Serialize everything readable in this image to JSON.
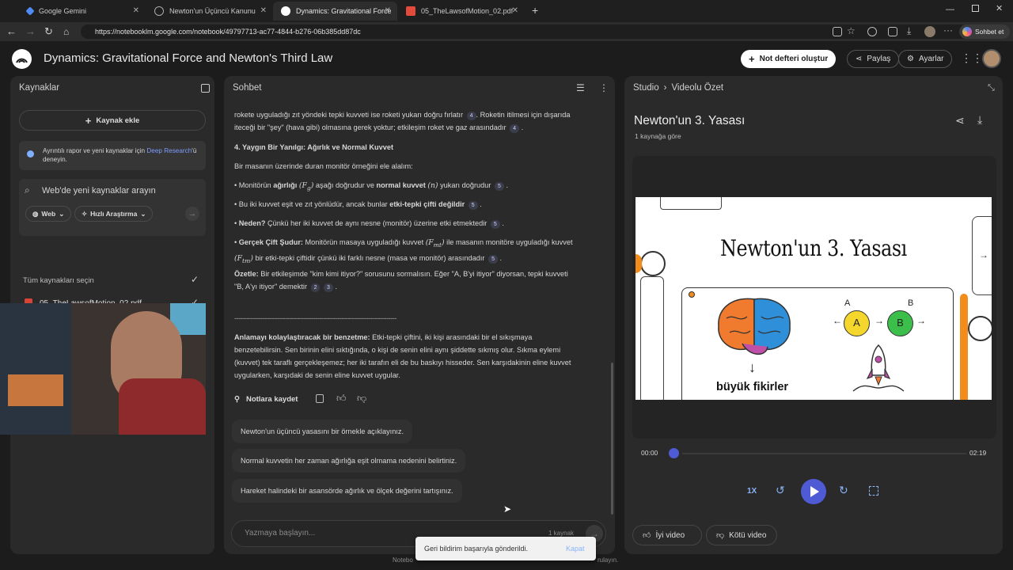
{
  "browser": {
    "tabs": [
      {
        "title": "Google Gemini",
        "active": false
      },
      {
        "title": "Newton'un Üçüncü Kanunu",
        "active": false
      },
      {
        "title": "Dynamics: Gravitational Force and",
        "active": true
      },
      {
        "title": "05_TheLawsofMotion_02.pdf",
        "active": false
      }
    ],
    "url": "https://notebooklm.google.com/notebook/49797713-ac77-4844-b276-06b385dd87dc",
    "profile_label": "Sohbet et"
  },
  "app": {
    "title": "Dynamics: Gravitational Force and Newton's Third Law",
    "new_notebook_label": "Not defteri oluştur",
    "share_label": "Paylaş",
    "settings_label": "Ayarlar"
  },
  "sources": {
    "header": "Kaynaklar",
    "add_label": "Kaynak ekle",
    "promo_text": "Ayrıntılı rapor ve yeni kaynaklar için",
    "promo_link": "Deep Research",
    "promo_suffix": "'ü deneyin.",
    "search_placeholder": "Web'de yeni kaynaklar arayın",
    "chip_web": "Web",
    "chip_research": "Hızlı Araştırma",
    "select_all_label": "Tüm kaynakları seçin",
    "items": [
      {
        "name": "05_TheLawsofMotion_02.pdf"
      }
    ]
  },
  "chat": {
    "header": "Sohbet",
    "p1a": "rokete uyguladığı zıt yöndeki tepki kuvveti ise roketi yukarı doğru fırlatır",
    "p1b": ". Roketin itilmesi için dışarıda",
    "p1c": "iteceği bir \"şey\" (hava gibi) olmasına gerek yoktur; etkileşim roket ve gaz arasındadır",
    "heading4": "4. Yaygın Bir Yanılgı: Ağırlık ve Normal Kuvvet",
    "intro": "Bir masanın üzerinde duran monitör örneğini ele alalım:",
    "b1a": "Monitörün ",
    "b1b": "ağırlığı",
    "b1c": "aşağı doğrudur ve ",
    "b1d": "normal kuvvet",
    "b1e": "yukarı doğrudur",
    "b2a": "Bu iki kuvvet eşit ve zıt yönlüdür, ancak bunlar ",
    "b2b": "etki-tepki çifti değildir",
    "b3a": "Neden?",
    "b3b": " Çünkü her iki kuvvet de aynı nesne (monitör) üzerine etki etmektedir",
    "b4a": "Gerçek Çift Şudur:",
    "b4b": " Monitörün masaya uyguladığı kuvvet",
    "b4c": " ile masanın monitöre uyguladığı kuvvet",
    "b4d": " bir etki-tepki çiftidir çünkü iki farklı nesne (masa ve monitör) arasındadır",
    "sum_a": "Özetle:",
    "sum_b": " Bir etkileşimde \"kim kimi itiyor?\" sorusunu sormalısın. Eğer \"A, B'yi itiyor\" diyorsan, tepki kuvveti",
    "sum_c": "\"B, A'yı itiyor\" demektir",
    "divider": "--------------------------------------------------------------------------------",
    "an_a": "Anlamayı kolaylaştıracak bir benzetme:",
    "an_b": " Etki-tepki çiftini, iki kişi arasındaki bir el sıkışmaya",
    "an_c": "benzetebilirsin. Sen birinin elini sıktığında, o kişi de senin elini aynı şiddette sıkmış olur. Sıkma eylemi",
    "an_d": "(kuvvet) tek taraflı gerçekleşemez; her iki tarafın eli de bu baskıyı hisseder. Sen karşıdakinin eline kuvvet",
    "an_e": "uygularken, karşıdaki de senin eline kuvvet uygular.",
    "save_note_label": "Notlara kaydet",
    "suggestions": [
      "Newton'un üçüncü yasasını bir örnekle açıklayınız.",
      "Normal kuvvetin her zaman ağırlığa eşit olmama nedenini belirtiniz.",
      "Hareket halindeki bir asansörde ağırlık ve ölçek değerini tartışınız."
    ],
    "input_placeholder": "Yazmaya başlayın...",
    "source_count": "1 kaynak",
    "toast_text": "Geri bildirim başarıyla gönderildi.",
    "toast_action": "Kapat",
    "footer_a": "Notebo",
    "footer_b": "rulayın."
  },
  "citations": {
    "c4": "4",
    "c5": "5",
    "c2": "2",
    "c3": "3"
  },
  "math": {
    "fg": "(F",
    "fg_sub": "g",
    "n": "(n)",
    "fmt": "(F",
    "fmt_sub": "mt",
    "ftm": "(F",
    "ftm_sub": "tm"
  },
  "studio": {
    "breadcrumb_root": "Studio",
    "breadcrumb_leaf": "Videolu Özet",
    "title": "Newton'un 3. Yasası",
    "subtitle": "1 kaynağa göre",
    "slide_title": "Newton'un 3. Yasası",
    "slide_caption": "büyük fikirler",
    "label_a": "A",
    "label_b": "B",
    "time_current": "00:00",
    "time_total": "02:19",
    "progress": 0.0,
    "speed": "1X",
    "good_label": "İyi video",
    "bad_label": "Kötü video"
  },
  "colors": {
    "accent": "#4f5bd5",
    "link": "#8ab4f8",
    "slide_bg": "#ffffff"
  }
}
